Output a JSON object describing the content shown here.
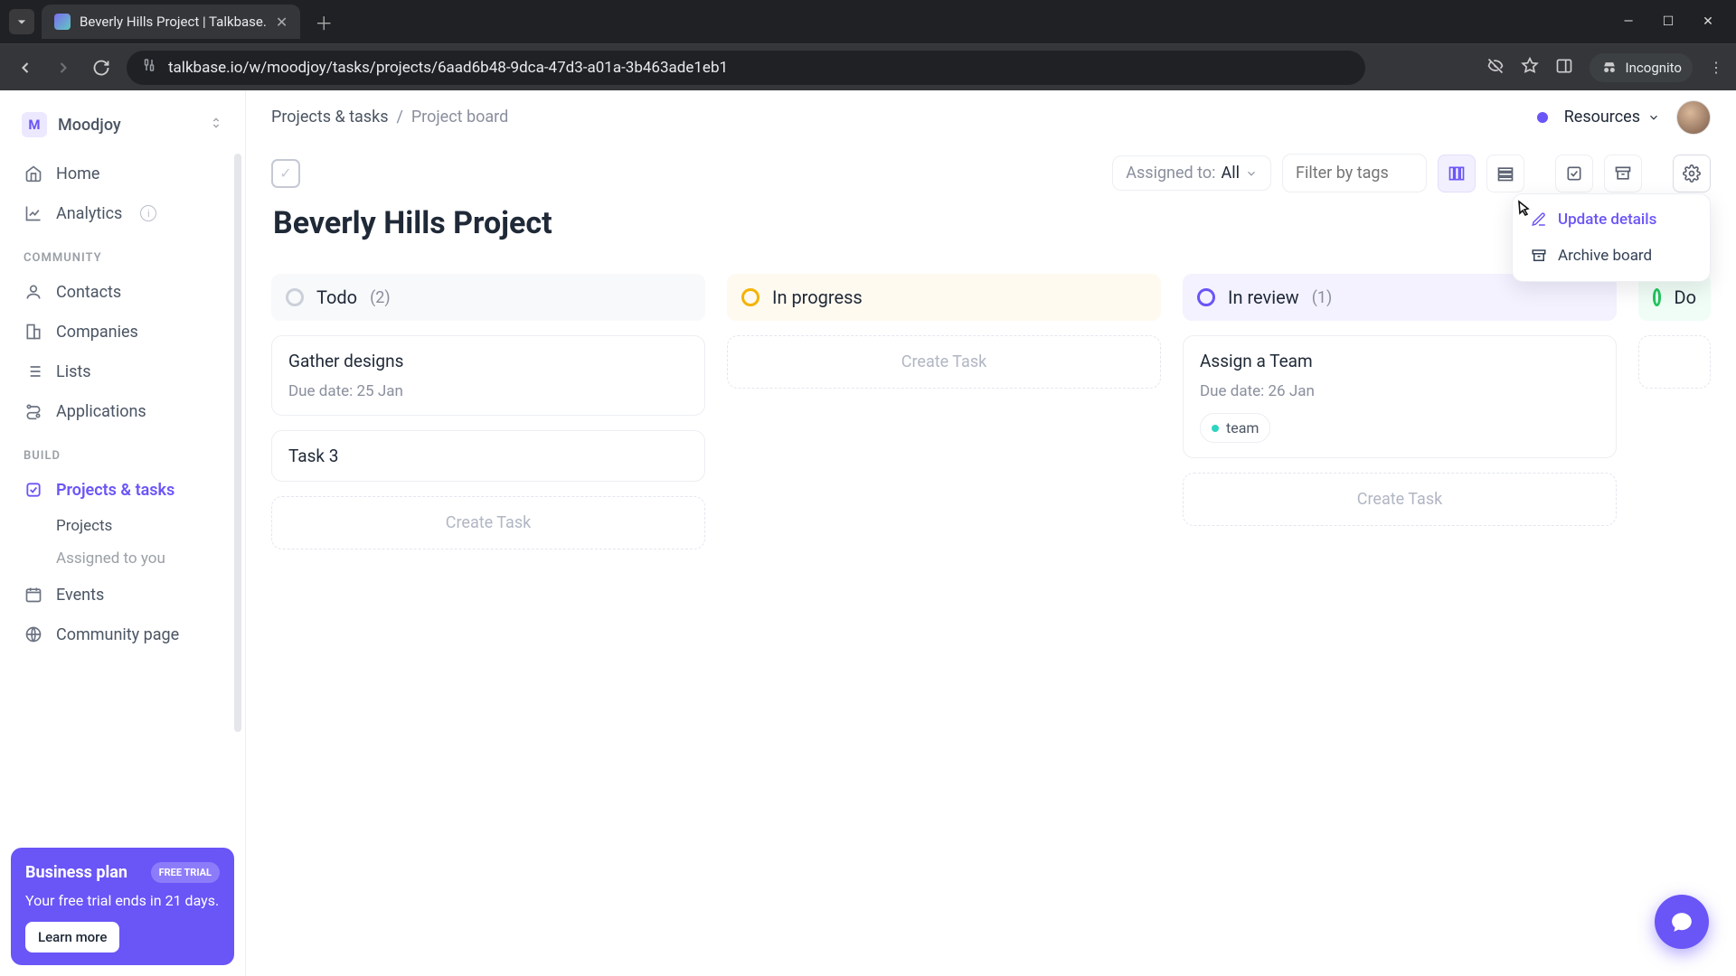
{
  "browser": {
    "tab_title": "Beverly Hills Project | Talkbase.",
    "url": "talkbase.io/w/moodjoy/tasks/projects/6aad6b48-9dca-47d3-a01a-3b463ade1eb1",
    "incognito_label": "Incognito"
  },
  "workspace": {
    "initial": "M",
    "name": "Moodjoy"
  },
  "sidebar": {
    "home": "Home",
    "analytics": "Analytics",
    "section_community": "COMMUNITY",
    "contacts": "Contacts",
    "companies": "Companies",
    "lists": "Lists",
    "applications": "Applications",
    "section_build": "BUILD",
    "projects_tasks": "Projects & tasks",
    "sub_projects": "Projects",
    "sub_assigned": "Assigned to you",
    "events": "Events",
    "community_page": "Community page"
  },
  "promo": {
    "title": "Business plan",
    "badge": "FREE TRIAL",
    "subtitle": "Your free trial ends in 21 days.",
    "button": "Learn more"
  },
  "header": {
    "crumb_root": "Projects & tasks",
    "crumb_separator": "/",
    "crumb_current": "Project board",
    "resources": "Resources"
  },
  "board_header": {
    "title": "Beverly Hills Project",
    "assigned_label": "Assigned to:",
    "assigned_value": "All",
    "filter_placeholder": "Filter by tags"
  },
  "settings_menu": {
    "update": "Update details",
    "archive": "Archive board"
  },
  "columns": {
    "todo": {
      "name": "Todo",
      "count": "(2)",
      "ring": "#cbd0da"
    },
    "inprogress": {
      "name": "In progress",
      "ring": "#f5b301"
    },
    "inreview": {
      "name": "In review",
      "count": "(1)",
      "ring": "#6a55f7"
    },
    "done": {
      "name": "Do",
      "ring": "#22c55e"
    }
  },
  "tasks": {
    "todo1_title": "Gather designs",
    "todo1_due": "Due date: 25 Jan",
    "todo2_title": "Task 3",
    "review1_title": "Assign a Team",
    "review1_due": "Due date: 26 Jan",
    "review1_tag": "team",
    "create_label": "Create Task"
  }
}
